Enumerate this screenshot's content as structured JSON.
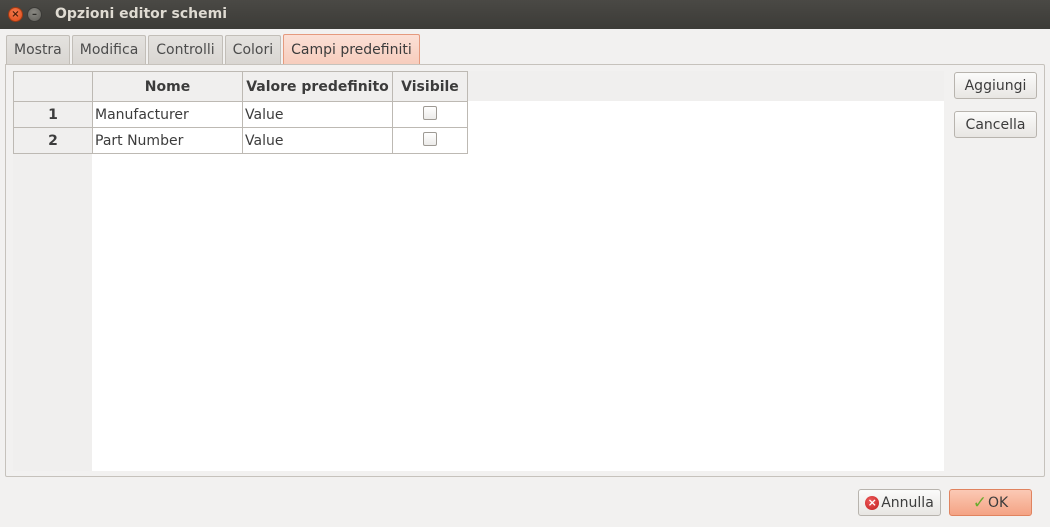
{
  "window": {
    "title": "Opzioni editor schemi",
    "close_glyph": "×",
    "minimize_glyph": "–"
  },
  "tabs": [
    {
      "label": "Mostra"
    },
    {
      "label": "Modifica"
    },
    {
      "label": "Controlli"
    },
    {
      "label": "Colori"
    },
    {
      "label": "Campi predefiniti",
      "active": true
    }
  ],
  "table": {
    "headers": {
      "name": "Nome",
      "value": "Valore predefinito",
      "visible": "Visibile"
    },
    "rows": [
      {
        "index": "1",
        "name": "Manufacturer",
        "value": "Value",
        "visible": false
      },
      {
        "index": "2",
        "name": "Part Number",
        "value": "Value",
        "visible": false
      }
    ]
  },
  "side_buttons": {
    "add_label": "Aggiungi",
    "delete_label": "Cancella"
  },
  "footer": {
    "cancel_label": "Annulla",
    "ok_label": "OK",
    "cancel_icon": "cancel-circle-icon",
    "ok_icon": "checkmark-icon",
    "cancel_glyph": "×",
    "ok_glyph": "✓"
  },
  "colors": {
    "titlebar": "#3c3b37",
    "accent": "#f4a384",
    "active_tab": "#f7cdbd"
  }
}
